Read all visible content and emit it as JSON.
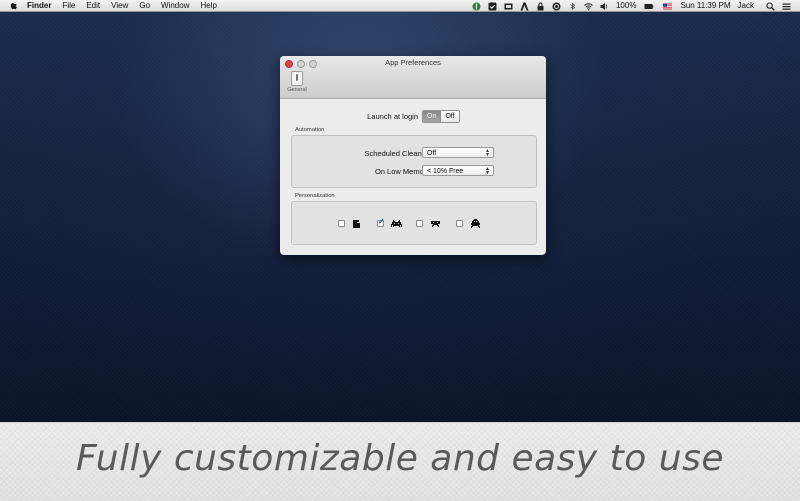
{
  "menubar": {
    "items": [
      "Finder",
      "File",
      "Edit",
      "View",
      "Go",
      "Window",
      "Help"
    ],
    "battery": "100%",
    "clock": "Sun 11:39 PM",
    "user": "Jack"
  },
  "window": {
    "title": "App Preferences",
    "toolbar_tab": "General",
    "launch_label": "Launch at login",
    "launch_on": "On",
    "launch_off": "Off",
    "automation": {
      "label": "Automation",
      "scheduled_label": "Scheduled Cleanup",
      "scheduled_value": "Off",
      "memory_label": "On Low Memory",
      "memory_value": "< 10% Free"
    },
    "personalization": {
      "label": "Personalization",
      "icons": [
        {
          "name": "pacman-icon",
          "checked": false
        },
        {
          "name": "invader-icon",
          "checked": true
        },
        {
          "name": "ufo-icon",
          "checked": false
        },
        {
          "name": "squid-icon",
          "checked": false
        }
      ]
    }
  },
  "banner": {
    "text": "Fully customizable and easy to use"
  },
  "colors": {
    "close_button": "#e0443e",
    "segment_selected": "#8a8a8a",
    "checkmark": "#1e4fa8"
  }
}
